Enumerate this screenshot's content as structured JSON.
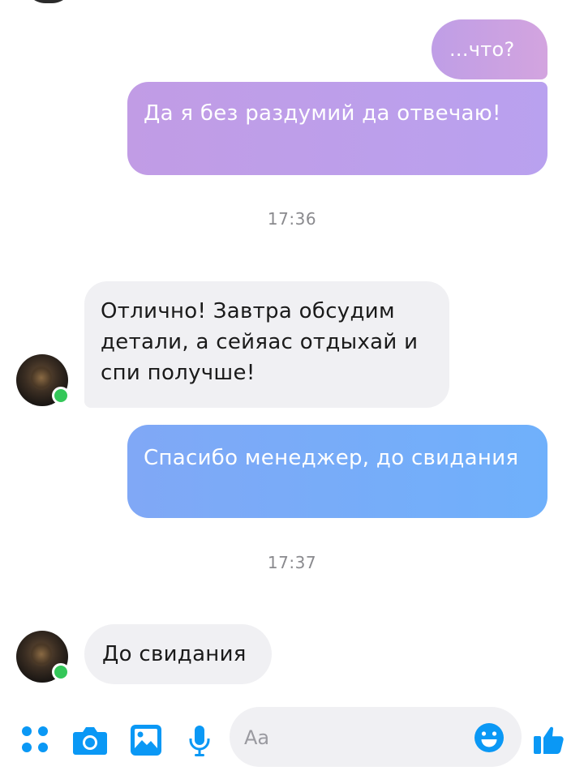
{
  "conversation": {
    "messages": [
      {
        "direction": "outgoing",
        "text": "...что?"
      },
      {
        "direction": "outgoing",
        "text": "Да я без раздумий да отвечаю!"
      },
      {
        "type": "timestamp",
        "text": "17:36"
      },
      {
        "direction": "incoming",
        "text": "Отлично! Завтра обсудим детали, а сейяас отдыхай и спи получше!"
      },
      {
        "direction": "outgoing",
        "text": "Спасибо менеджер, до свидания"
      },
      {
        "type": "timestamp",
        "text": "17:37"
      },
      {
        "direction": "incoming",
        "text": "До свидания"
      }
    ]
  },
  "composer": {
    "placeholder": "Aa",
    "icons": [
      "apps-icon",
      "camera-icon",
      "gallery-icon",
      "microphone-icon",
      "emoji-icon",
      "like-icon"
    ]
  },
  "colors": {
    "accent": "#0a98f5",
    "outgoing_purple": "#c19ce5",
    "outgoing_blue": "#6fb0fb",
    "incoming_bg": "#f0f0f3",
    "online": "#34c759"
  }
}
